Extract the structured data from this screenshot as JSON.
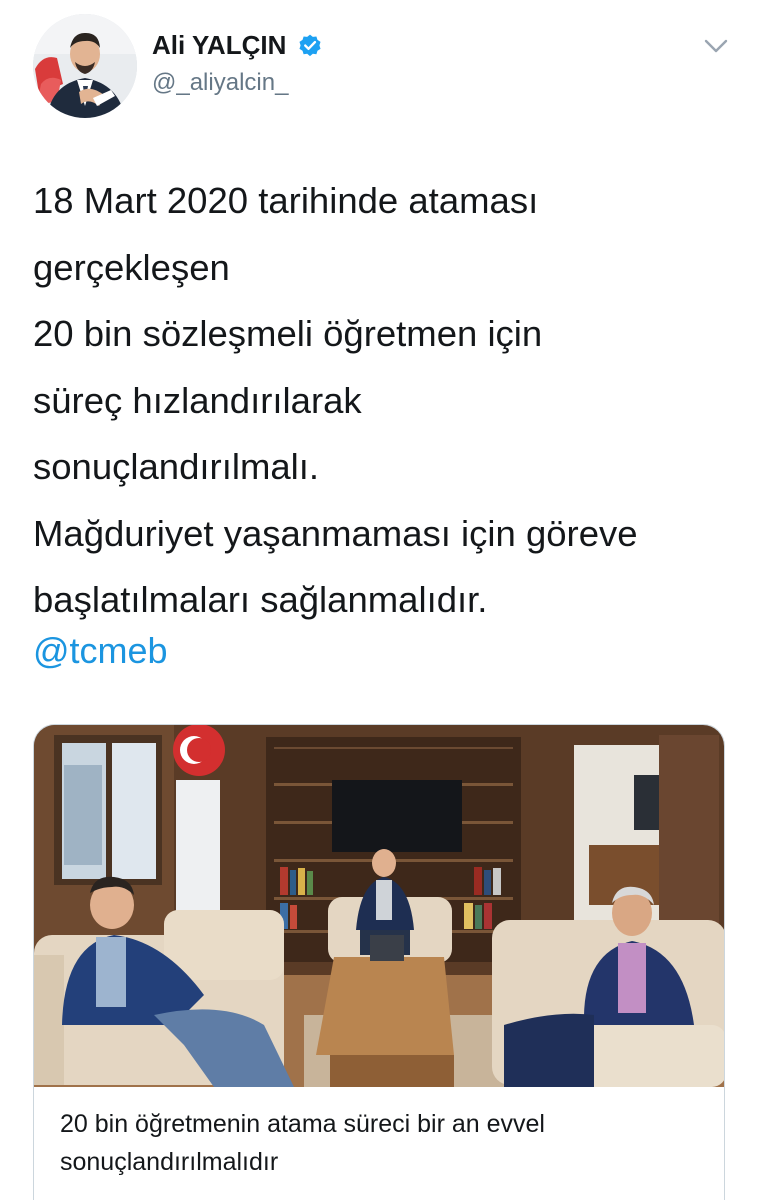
{
  "author": {
    "display_name": "Ali YALÇIN",
    "handle": "@_aliyalcin_",
    "verified": true,
    "avatar_icon": "profile-photo"
  },
  "menu": {
    "icon": "chevron-down-icon"
  },
  "tweet": {
    "lines": [
      "18 Mart 2020 tarihinde ataması",
      "gerçekleşen",
      "20 bin sözleşmeli öğretmen için",
      "süreç hızlandırılarak",
      "sonuçlandırılmalı.",
      "Mağduriyet yaşanmaması için göreve",
      "başlatılmaları sağlanmalıdır."
    ],
    "mention": "@tcmeb"
  },
  "card": {
    "image_icon": "office-meeting-photo",
    "title_lines": [
      "20 bin öğretmenin atama süreci bir an evvel",
      "sonuçlandırılmalıdır"
    ]
  },
  "colors": {
    "link": "#1b95e0",
    "verified": "#1da1f2",
    "text": "#14171a",
    "secondary": "#657786",
    "border": "#ccd6dd"
  }
}
